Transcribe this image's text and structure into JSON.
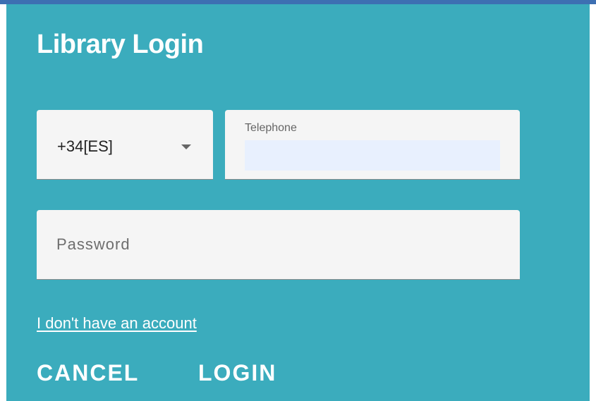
{
  "dialog": {
    "title": "Library Login"
  },
  "country_select": {
    "value": "+34[ES]",
    "icon": "dropdown-arrow-icon"
  },
  "telephone": {
    "label": "Telephone",
    "value": ""
  },
  "password": {
    "placeholder": "Password",
    "value": ""
  },
  "links": {
    "no_account": "I don't have an account"
  },
  "actions": {
    "cancel_label": "CANCEL",
    "login_label": "LOGIN"
  },
  "colors": {
    "panel_background": "#3bacbd",
    "field_background": "#f5f5f5",
    "autofill_background": "#e8f0fe",
    "top_rule": "#3d6fb2",
    "text_on_panel": "#ffffff"
  }
}
